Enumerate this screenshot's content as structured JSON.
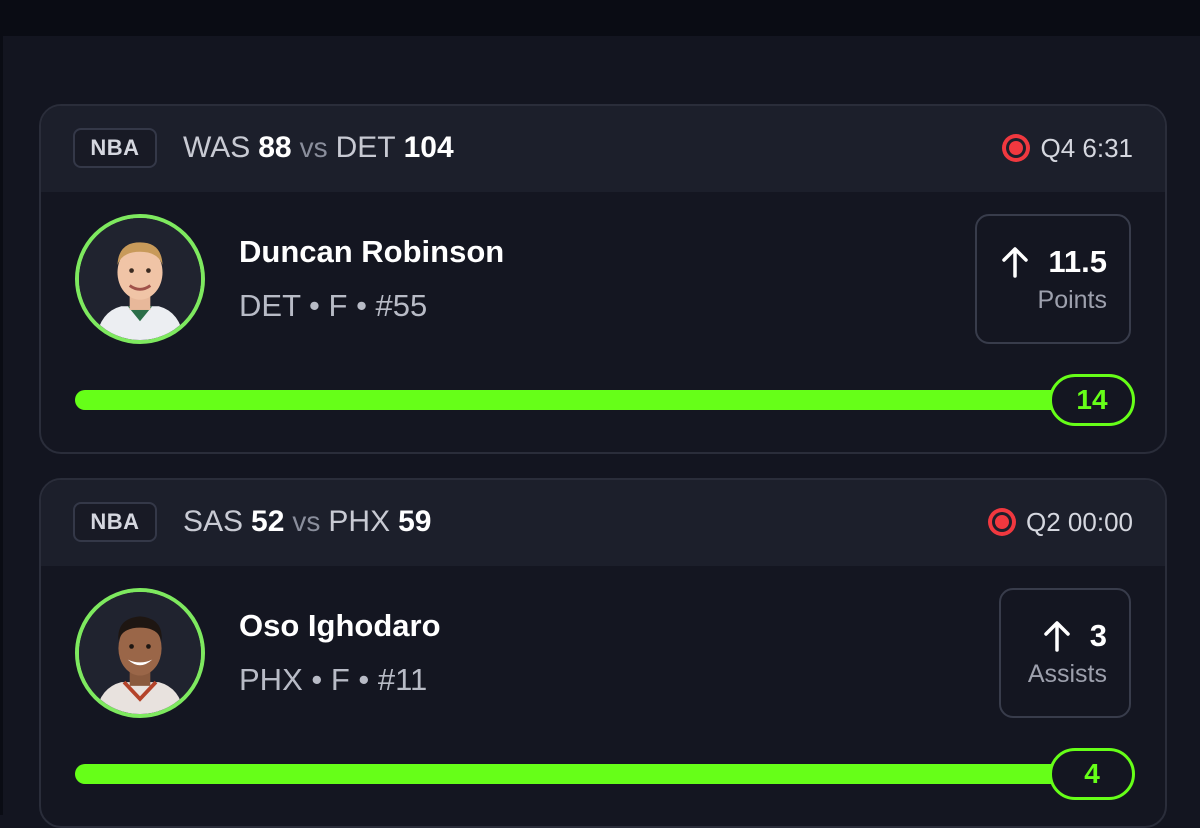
{
  "cards": [
    {
      "league": "NBA",
      "away_team": "WAS",
      "away_score": "88",
      "vs": "vs",
      "home_team": "DET",
      "home_score": "104",
      "game_clock": "Q4 6:31",
      "player_name": "Duncan Robinson",
      "player_meta": "DET • F • #55",
      "line_value": "11.5",
      "line_stat": "Points",
      "line_direction": "up-arrow-icon",
      "current_value": "14",
      "progress_percent": 100
    },
    {
      "league": "NBA",
      "away_team": "SAS",
      "away_score": "52",
      "vs": "vs",
      "home_team": "PHX",
      "home_score": "59",
      "game_clock": "Q2 00:00",
      "player_name": "Oso Ighodaro",
      "player_meta": "PHX • F • #11",
      "line_value": "3",
      "line_stat": "Assists",
      "line_direction": "up-arrow-icon",
      "current_value": "4",
      "progress_percent": 100
    }
  ],
  "colors": {
    "accent_green": "#66ff18",
    "ring_green": "#7ee95f",
    "live_red": "#f0383f",
    "background": "#131520",
    "card_header": "#1c1f2b"
  }
}
